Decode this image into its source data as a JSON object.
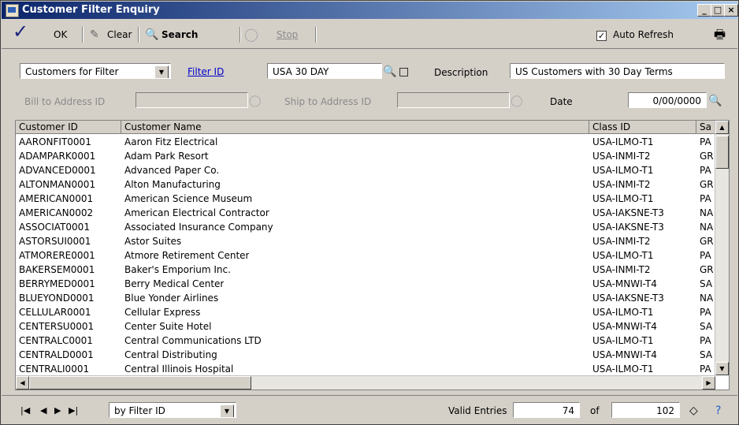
{
  "window": {
    "title": "Customer Filter Enquiry"
  },
  "toolbar": {
    "ok": "OK",
    "clear": "Clear",
    "search": "Search",
    "stop": "Stop",
    "auto_refresh": "Auto Refresh",
    "auto_refresh_checked": true
  },
  "filter": {
    "type_value": "Customers for Filter",
    "filter_id_label": "Filter ID",
    "filter_id_value": "USA 30 DAY",
    "description_label": "Description",
    "description_value": "US Customers with 30 Day Terms",
    "bill_to_label": "Bill to Address ID",
    "bill_to_value": "",
    "ship_to_label": "Ship to Address ID",
    "ship_to_value": "",
    "date_label": "Date",
    "date_value": "0/00/0000"
  },
  "grid": {
    "columns": [
      "Customer ID",
      "Customer Name",
      "Class ID",
      "Sa"
    ],
    "rows": [
      [
        "AARONFIT0001",
        "Aaron Fitz Electrical",
        "USA-ILMO-T1",
        "PA"
      ],
      [
        "ADAMPARK0001",
        "Adam Park Resort",
        "USA-INMI-T2",
        "GR"
      ],
      [
        "ADVANCED0001",
        "Advanced Paper Co.",
        "USA-ILMO-T1",
        "PA"
      ],
      [
        "ALTONMAN0001",
        "Alton Manufacturing",
        "USA-INMI-T2",
        "GR"
      ],
      [
        "AMERICAN0001",
        "American Science Museum",
        "USA-ILMO-T1",
        "PA"
      ],
      [
        "AMERICAN0002",
        "American Electrical Contractor",
        "USA-IAKSNE-T3",
        "NA"
      ],
      [
        "ASSOCIAT0001",
        "Associated Insurance Company",
        "USA-IAKSNE-T3",
        "NA"
      ],
      [
        "ASTORSUI0001",
        "Astor Suites",
        "USA-INMI-T2",
        "GR"
      ],
      [
        "ATMORERE0001",
        "Atmore Retirement Center",
        "USA-ILMO-T1",
        "PA"
      ],
      [
        "BAKERSEM0001",
        "Baker's Emporium Inc.",
        "USA-INMI-T2",
        "GR"
      ],
      [
        "BERRYMED0001",
        "Berry Medical Center",
        "USA-MNWI-T4",
        "SA"
      ],
      [
        "BLUEYOND0001",
        "Blue Yonder Airlines",
        "USA-IAKSNE-T3",
        "NA"
      ],
      [
        "CELLULAR0001",
        "Cellular Express",
        "USA-ILMO-T1",
        "PA"
      ],
      [
        "CENTERSU0001",
        "Center Suite Hotel",
        "USA-MNWI-T4",
        "SA"
      ],
      [
        "CENTRALC0001",
        "Central Communications LTD",
        "USA-ILMO-T1",
        "PA"
      ],
      [
        "CENTRALD0001",
        "Central Distributing",
        "USA-MNWI-T4",
        "SA"
      ],
      [
        "CENTRALI0001",
        "Central Illinois Hospital",
        "USA-ILMO-T1",
        "PA"
      ]
    ]
  },
  "bottom": {
    "sort_value": "by Filter ID",
    "valid_entries_label": "Valid Entries",
    "valid_entries": "74",
    "of_label": "of",
    "total": "102"
  }
}
